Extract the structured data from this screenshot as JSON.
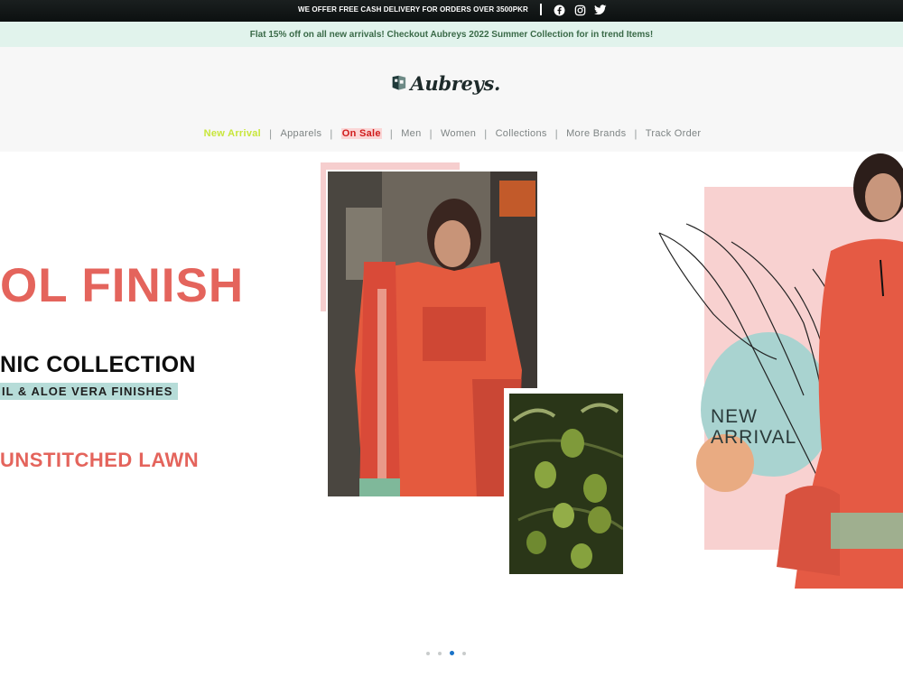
{
  "topbar": {
    "delivery_text": "WE OFFER FREE CASH DELIVERY FOR ORDERS OVER 3500PKR",
    "social_icons": [
      "facebook-icon",
      "instagram-icon",
      "twitter-icon"
    ]
  },
  "promo": {
    "text": "Flat 15% off on all new arrivals! Checkout Aubreys 2022 Summer Collection for in trend Items!"
  },
  "logo": {
    "text": "Aubreys."
  },
  "nav": {
    "items": [
      {
        "label": "New Arrival"
      },
      {
        "label": "Apparels"
      },
      {
        "label": "On Sale"
      },
      {
        "label": "Men"
      },
      {
        "label": "Women"
      },
      {
        "label": "Collections"
      },
      {
        "label": "More Brands"
      },
      {
        "label": "Track Order"
      }
    ],
    "divider": "|"
  },
  "hero": {
    "headline": "OL FINISH",
    "subheadline": "NIC COLLECTION",
    "tagline": "IL & ALOE VERA FINISHES",
    "product": "UNSTITCHED LAWN",
    "badge_line1": "NEW",
    "badge_line2": "ARRIVAL"
  },
  "carousel": {
    "slide_count": 4,
    "active_index": 2
  },
  "colors": {
    "accent_coral": "#e4645c",
    "promo_bg": "#e1f3ec",
    "teal": "#a9d3d0",
    "pink": "#f8d1d0",
    "new_arrival_nav": "#c8e63b",
    "on_sale_nav": "#d01c1c"
  }
}
